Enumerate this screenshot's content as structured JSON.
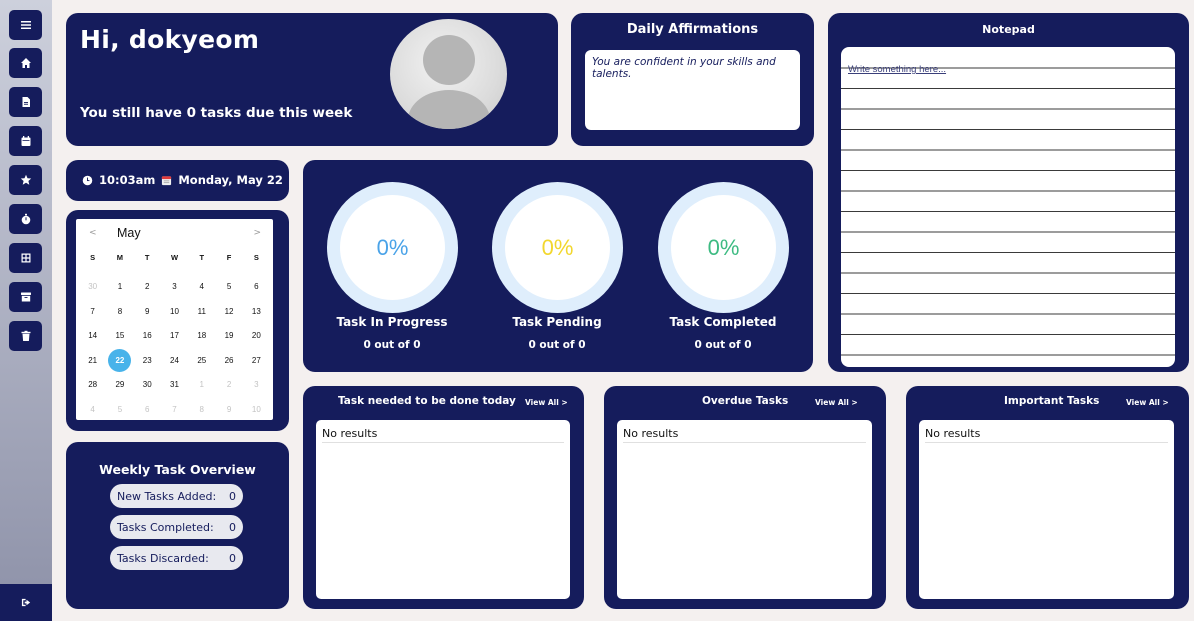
{
  "sidebar": {
    "menu_icon": "hamburger-icon",
    "items": [
      {
        "icon": "home-icon"
      },
      {
        "icon": "document-icon"
      },
      {
        "icon": "calendar-icon"
      },
      {
        "icon": "star-icon"
      },
      {
        "icon": "stopwatch-icon"
      },
      {
        "icon": "grid-icon"
      },
      {
        "icon": "archive-icon"
      },
      {
        "icon": "trash-icon"
      }
    ],
    "logout_icon": "logout-icon"
  },
  "greeting": {
    "title": "Hi, dokyeom",
    "subtitle": "You still have 0 tasks due this week"
  },
  "affirmations": {
    "title": "Daily Affirmations",
    "text": "You are confident in your skills and talents."
  },
  "notepad": {
    "title": "Notepad",
    "placeholder": "Write something here..."
  },
  "clock": {
    "time": "10:03am",
    "date": "Monday, May 22"
  },
  "calendar": {
    "prev": "<",
    "next": ">",
    "month": "May",
    "weekdays": [
      "S",
      "M",
      "T",
      "W",
      "T",
      "F",
      "S"
    ],
    "days": [
      {
        "d": "30",
        "m": true
      },
      {
        "d": "1"
      },
      {
        "d": "2"
      },
      {
        "d": "3"
      },
      {
        "d": "4"
      },
      {
        "d": "5"
      },
      {
        "d": "6"
      },
      {
        "d": "7"
      },
      {
        "d": "8"
      },
      {
        "d": "9"
      },
      {
        "d": "10"
      },
      {
        "d": "11"
      },
      {
        "d": "12"
      },
      {
        "d": "13"
      },
      {
        "d": "14"
      },
      {
        "d": "15"
      },
      {
        "d": "16"
      },
      {
        "d": "17"
      },
      {
        "d": "18"
      },
      {
        "d": "19"
      },
      {
        "d": "20"
      },
      {
        "d": "21"
      },
      {
        "d": "22",
        "today": true
      },
      {
        "d": "23"
      },
      {
        "d": "24"
      },
      {
        "d": "25"
      },
      {
        "d": "26"
      },
      {
        "d": "27"
      },
      {
        "d": "28"
      },
      {
        "d": "29"
      },
      {
        "d": "30"
      },
      {
        "d": "31"
      },
      {
        "d": "1",
        "m": true
      },
      {
        "d": "2",
        "m": true
      },
      {
        "d": "3",
        "m": true
      },
      {
        "d": "4",
        "m": true
      },
      {
        "d": "5",
        "m": true
      },
      {
        "d": "6",
        "m": true
      },
      {
        "d": "7",
        "m": true
      },
      {
        "d": "8",
        "m": true
      },
      {
        "d": "9",
        "m": true
      },
      {
        "d": "10",
        "m": true
      }
    ]
  },
  "weekly": {
    "title": "Weekly Task Overview",
    "new_label": "New Tasks Added:",
    "new_value": "0",
    "completed_label": "Tasks Completed:",
    "completed_value": "0",
    "discarded_label": "Tasks Discarded:",
    "discarded_value": "0"
  },
  "progress": {
    "in_progress": {
      "percent": "0%",
      "label": "Task In Progress",
      "count": "0 out of 0",
      "color": "#4aa3e8"
    },
    "pending": {
      "percent": "0%",
      "label": "Task Pending",
      "count": "0 out of 0",
      "color": "#f2d72e"
    },
    "completed": {
      "percent": "0%",
      "label": "Task Completed",
      "count": "0 out of 0",
      "color": "#3dbb82"
    }
  },
  "lists": {
    "today": {
      "title": "Task needed to be done today",
      "link": "View All >",
      "empty": "No results"
    },
    "overdue": {
      "title": "Overdue Tasks",
      "link": "View All >",
      "empty": "No results"
    },
    "important": {
      "title": "Important Tasks",
      "link": "View All >",
      "empty": "No results"
    }
  },
  "colors": {
    "panel": "#151c5c",
    "background": "#f4f0ef",
    "today_highlight": "#48b3ea"
  }
}
